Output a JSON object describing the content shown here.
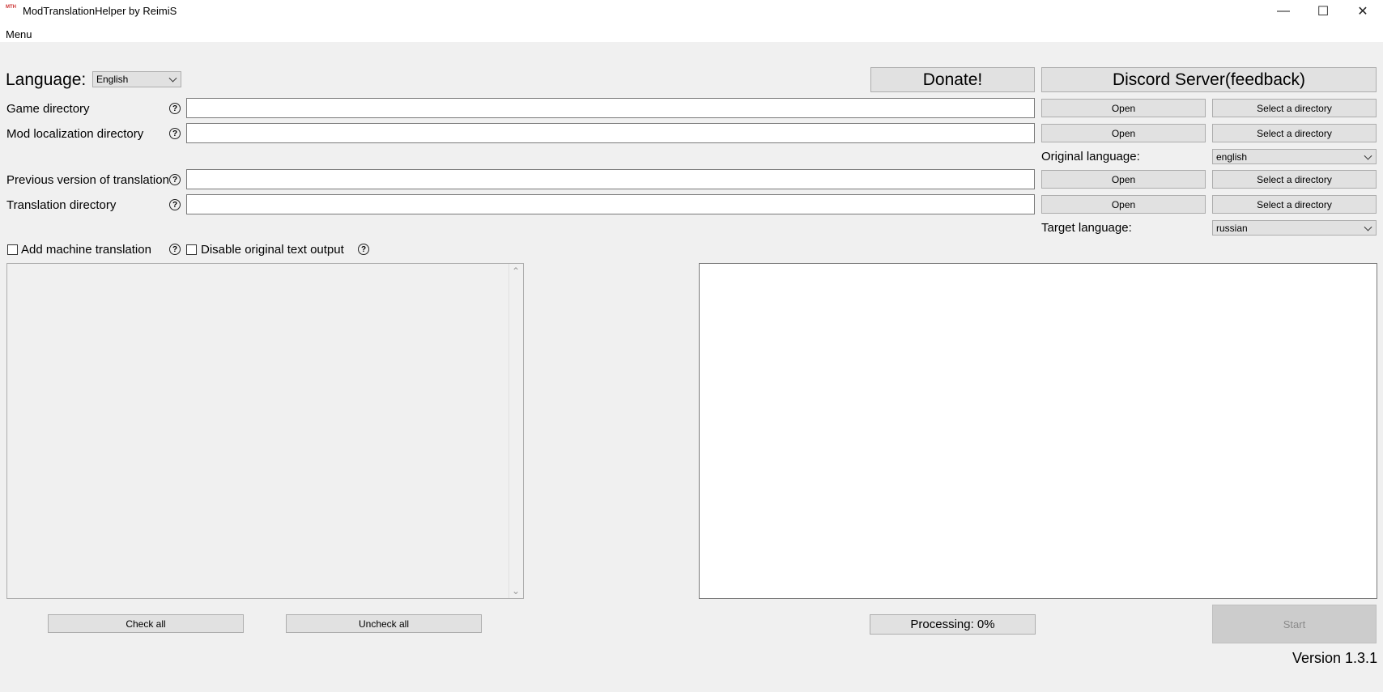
{
  "window": {
    "title": "ModTranslationHelper by ReimiS",
    "icon_text": "MTH",
    "minimize_glyph": "—",
    "maximize_glyph": "☐",
    "close_glyph": "✕"
  },
  "menu": {
    "label": "Menu"
  },
  "language": {
    "label": "Language:",
    "selected": "English"
  },
  "buttons": {
    "donate": "Donate!",
    "discord": "Discord Server(feedback)",
    "open": "Open",
    "select_directory": "Select a directory",
    "check_all": "Check all",
    "uncheck_all": "Uncheck all",
    "processing": "Processing: 0%",
    "start": "Start"
  },
  "rows": {
    "game_directory": {
      "label": "Game directory",
      "value": ""
    },
    "mod_localization_directory": {
      "label": "Mod localization directory",
      "value": ""
    },
    "previous_version": {
      "label": "Previous version of translation",
      "value": ""
    },
    "translation_directory": {
      "label": "Translation directory",
      "value": ""
    }
  },
  "help_glyph": "?",
  "original_language": {
    "label": "Original language:",
    "selected": "english"
  },
  "target_language": {
    "label": "Target language:",
    "selected": "russian"
  },
  "options": {
    "add_machine_translation": {
      "label": "Add machine translation",
      "checked": false
    },
    "disable_original_text_output": {
      "label": "Disable original text output",
      "checked": false
    }
  },
  "version": "Version 1.3.1",
  "scroll": {
    "up": "⌃",
    "down": "⌄"
  }
}
